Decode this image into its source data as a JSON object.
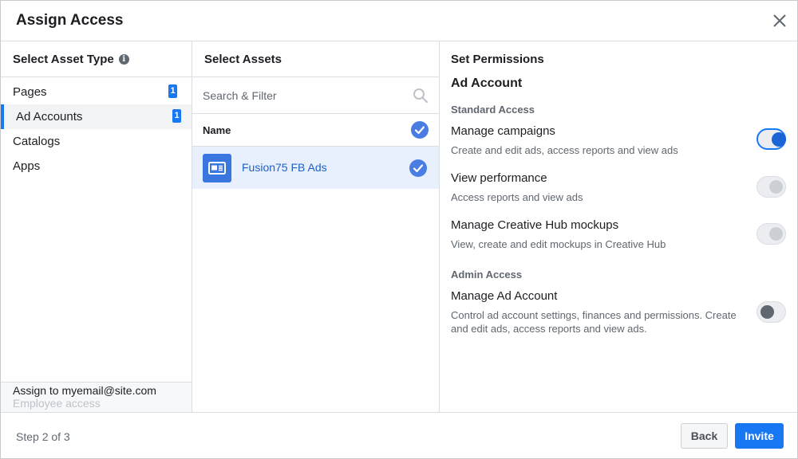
{
  "dialog": {
    "title": "Assign Access"
  },
  "asset_types": {
    "header": "Select Asset Type",
    "items": [
      {
        "label": "Pages",
        "count": "1"
      },
      {
        "label": "Ad Accounts",
        "count": "1"
      },
      {
        "label": "Catalogs"
      },
      {
        "label": "Apps"
      }
    ],
    "active_index": 1,
    "assign_to": "Assign to myemail@site.com",
    "access_type": "Employee access"
  },
  "assets": {
    "header": "Select Assets",
    "search_placeholder": "Search & Filter",
    "column_name": "Name",
    "items": [
      {
        "name": "Fusion75 FB Ads",
        "selected": true
      }
    ]
  },
  "permissions": {
    "header": "Set Permissions",
    "section_title": "Ad Account",
    "standard_label": "Standard Access",
    "admin_label": "Admin Access",
    "items": [
      {
        "title": "Manage campaigns",
        "desc": "Create and edit ads, access reports and view ads",
        "state": "on"
      },
      {
        "title": "View performance",
        "desc": "Access reports and view ads",
        "state": "disabled"
      },
      {
        "title": "Manage Creative Hub mockups",
        "desc": "View, create and edit mockups in Creative Hub",
        "state": "disabled"
      },
      {
        "title": "Manage Ad Account",
        "desc": "Control ad account settings, finances and permissions. Create and edit ads, access reports and view ads.",
        "state": "off"
      }
    ]
  },
  "footer": {
    "step": "Step 2 of 3",
    "back_label": "Back",
    "invite_label": "Invite"
  },
  "colors": {
    "accent": "#1877f2",
    "selected_row": "#e7f0fc",
    "check": "#4a7de2"
  }
}
